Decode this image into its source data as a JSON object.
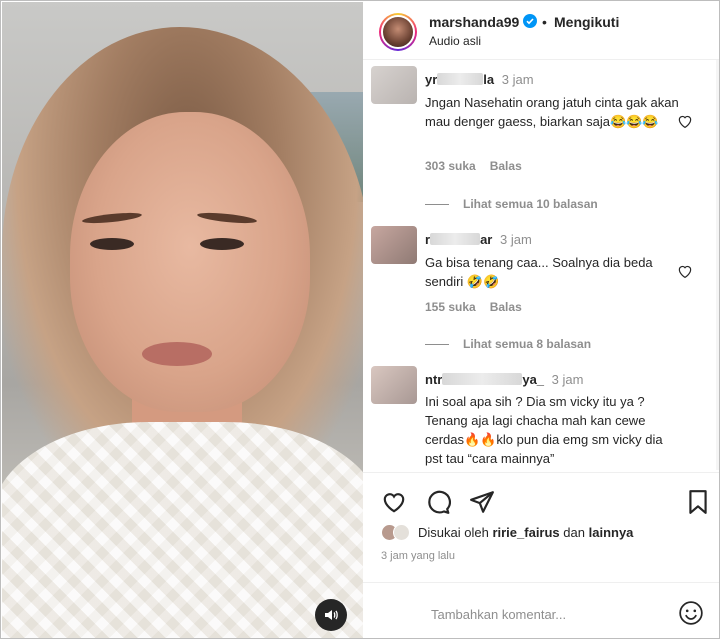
{
  "post": {
    "username": "marshanda99",
    "dot": "•",
    "follow_status": "Mengikuti",
    "audio": "Audio asli"
  },
  "comments": [
    {
      "user_start": "yr",
      "user_end": "la",
      "time": "3 jam",
      "text": "Jngan Nasehatin orang jatuh cinta gak akan mau denger gaess, biarkan saja😂😂😂",
      "likes": "303 suka",
      "reply": "Balas",
      "view_replies": "Lihat semua 10 balasan"
    },
    {
      "user_start": "r",
      "user_end": "ar",
      "time": "3 jam",
      "text": "Ga bisa tenang caa... Soalnya dia beda sendiri 🤣🤣",
      "likes": "155 suka",
      "reply": "Balas",
      "view_replies": "Lihat semua 8 balasan"
    },
    {
      "user_start": "ntr",
      "user_end": "ya_",
      "time": "3 jam",
      "text": "Ini soal apa sih ? Dia sm vicky itu ya ? Tenang aja lagi chacha mah kan cewe cerdas🔥🔥klo pun dia emg sm vicky dia pst tau “cara mainnya”",
      "likes": "",
      "reply": "",
      "view_replies": ""
    }
  ],
  "likes_line": {
    "prefix": "Disukai oleh",
    "user": "ririe_fairus",
    "conj": "dan",
    "others": "lainnya"
  },
  "posted_time": "3 jam yang lalu",
  "add_comment_placeholder": "Tambahkan komentar...",
  "colors": {
    "verified": "#0095f6",
    "text": "#262626",
    "muted": "#8e8e8e"
  },
  "icons": [
    "heart-icon",
    "comment-icon",
    "share-icon",
    "bookmark-icon",
    "emoji-icon",
    "speaker-icon",
    "verified-icon"
  ]
}
